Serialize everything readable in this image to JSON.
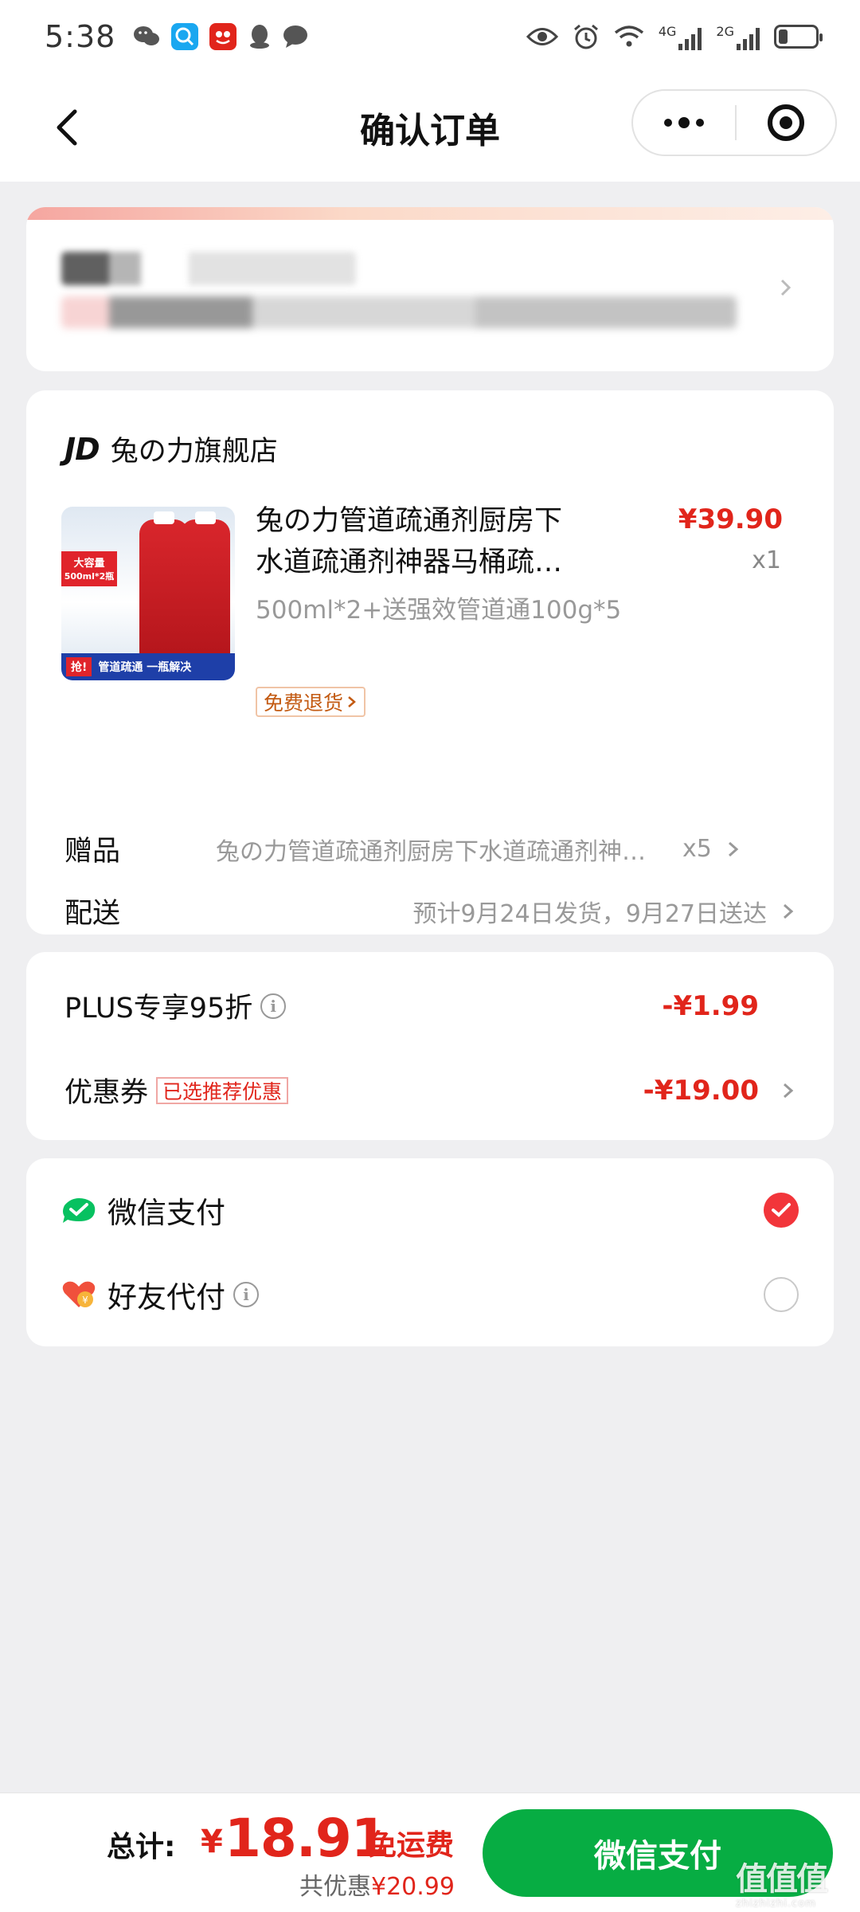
{
  "status_bar": {
    "time": "5:38",
    "net1": "4G",
    "net2": "2G",
    "battery_level": 0.25,
    "app_icons": [
      "wechat-icon",
      "search-app-icon",
      "jd-app-icon",
      "qq-icon",
      "message-icon"
    ]
  },
  "header": {
    "title": "确认订单",
    "back_icon": "chevron-left-icon",
    "more_icon": "more-dots-icon",
    "close_icon": "target-circle-icon"
  },
  "shop": {
    "logo": "JD",
    "name": "兔の力旗舰店"
  },
  "product": {
    "title_line1": "兔の力管道疏通剂厨房下",
    "title_line2": "水道疏通剂神器马桶疏…",
    "price": "¥39.90",
    "qty": "x1",
    "spec": "500ml*2+送强效管道通100g*5",
    "badge": "免费退货",
    "image": {
      "tag_line1": "大容量",
      "tag_line2": "500ml*2瓶",
      "strip_grab": "抢!",
      "strip_text": "管道疏通 一瓶解决"
    }
  },
  "gift": {
    "label": "赠品",
    "value": "兔の力管道疏通剂厨房下水道疏通剂神器马桶疏通",
    "qty": "x5"
  },
  "delivery": {
    "label": "配送",
    "value": "预计9月24日发货，9月27日送达"
  },
  "discounts": {
    "plus_label": "PLUS专享95折",
    "plus_amount": "-¥1.99",
    "coupon_label": "优惠券",
    "coupon_tag": "已选推荐优惠",
    "coupon_amount": "-¥19.00"
  },
  "payment": {
    "wechat_label": "微信支付",
    "friend_label": "好友代付",
    "selected": "wechat",
    "colors": {
      "wechat_green": "#07ad43",
      "accent_red": "#e1251b"
    }
  },
  "bottom": {
    "total_label": "总计:",
    "currency": "¥",
    "total_amount": "18.91",
    "free_shipping": "免运费",
    "saved_prefix": "共优惠",
    "saved_amount": "¥20.99",
    "pay_button": "微信支付"
  },
  "watermark": {
    "text": "值值值",
    "sub": "zhizhizhi.com"
  }
}
